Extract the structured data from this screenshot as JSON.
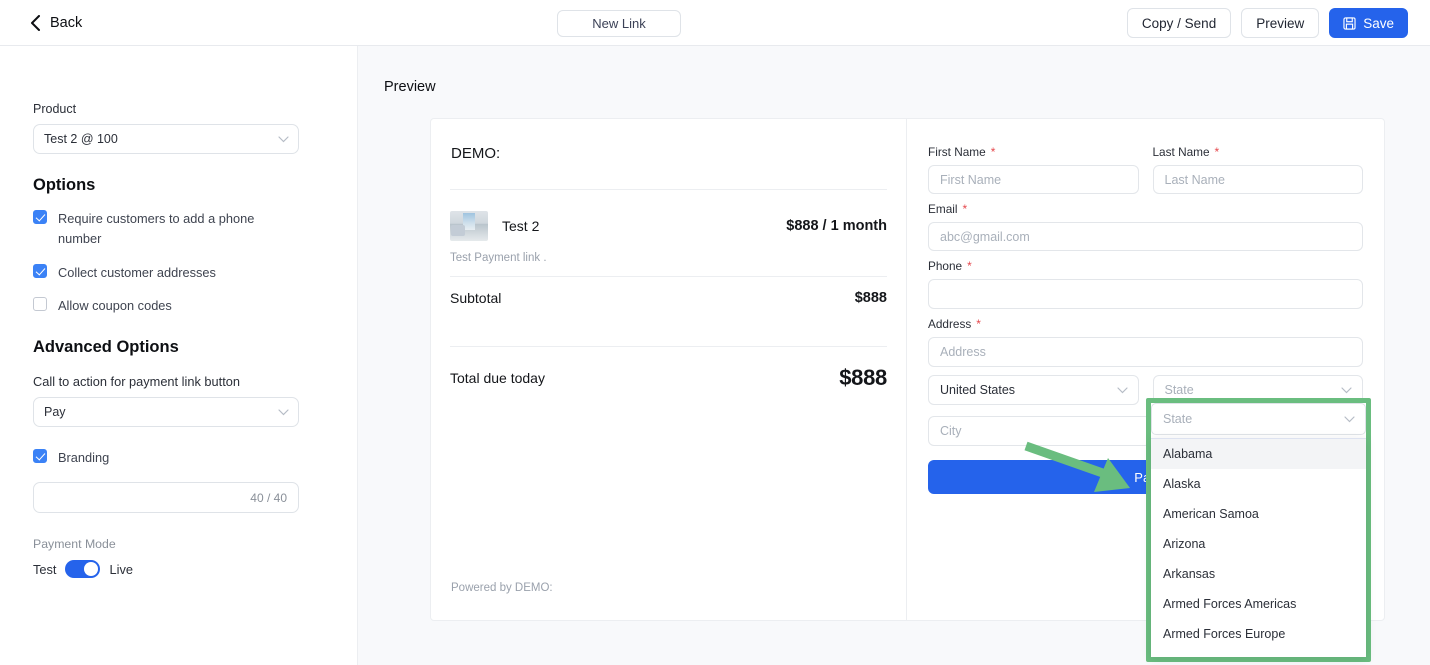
{
  "topbar": {
    "back_label": "Back",
    "back_icon": "chevron-left-icon",
    "new_link_label": "New Link",
    "copy_send_label": "Copy / Send",
    "preview_label": "Preview",
    "save_label": "Save",
    "save_icon": "save-disk-icon",
    "primary_color": "#2563eb"
  },
  "sidebar": {
    "product_label": "Product",
    "product_value": "Test 2 @ 100",
    "options_title": "Options",
    "options": [
      {
        "label": "Require customers to add a phone number",
        "checked": true
      },
      {
        "label": "Collect customer addresses",
        "checked": true
      },
      {
        "label": "Allow coupon codes",
        "checked": false
      }
    ],
    "advanced_title": "Advanced Options",
    "cta_label": "Call to action for payment link button",
    "cta_value": "Pay",
    "branding_label": "Branding",
    "branding_checked": true,
    "branding_counter": "40 / 40",
    "payment_mode_label": "Payment Mode",
    "mode_test": "Test",
    "mode_live": "Live",
    "mode_is_live": true
  },
  "main": {
    "preview_heading": "Preview"
  },
  "checkout": {
    "heading": "DEMO:",
    "product_name": "Test 2",
    "product_price": "$888 / 1 month",
    "product_desc": "Test Payment link .",
    "subtotal_label": "Subtotal",
    "subtotal_value": "$888",
    "total_label": "Total due today",
    "total_value": "$888",
    "powered_by": "Powered by DEMO:"
  },
  "form": {
    "first_name": {
      "label": "First Name",
      "placeholder": "First Name",
      "value": "",
      "required": true
    },
    "last_name": {
      "label": "Last Name",
      "placeholder": "Last Name",
      "value": "",
      "required": true
    },
    "email": {
      "label": "Email",
      "placeholder": "abc@gmail.com",
      "value": "",
      "required": true
    },
    "phone": {
      "label": "Phone",
      "placeholder": "",
      "value": "",
      "required": true
    },
    "address": {
      "label": "Address",
      "placeholder": "Address",
      "value": "",
      "required": true
    },
    "country": {
      "value": "United States"
    },
    "city": {
      "placeholder": "City",
      "value": ""
    },
    "state": {
      "placeholder": "State",
      "value": ""
    },
    "pay_button_label": "Pay"
  },
  "state_dropdown": {
    "placeholder": "State",
    "highlight_color": "#6abd7f",
    "options": [
      "Alabama",
      "Alaska",
      "American Samoa",
      "Arizona",
      "Arkansas",
      "Armed Forces Americas",
      "Armed Forces Europe"
    ],
    "active_index": 0
  },
  "annotation": {
    "arrow_color": "#6abd7f"
  }
}
